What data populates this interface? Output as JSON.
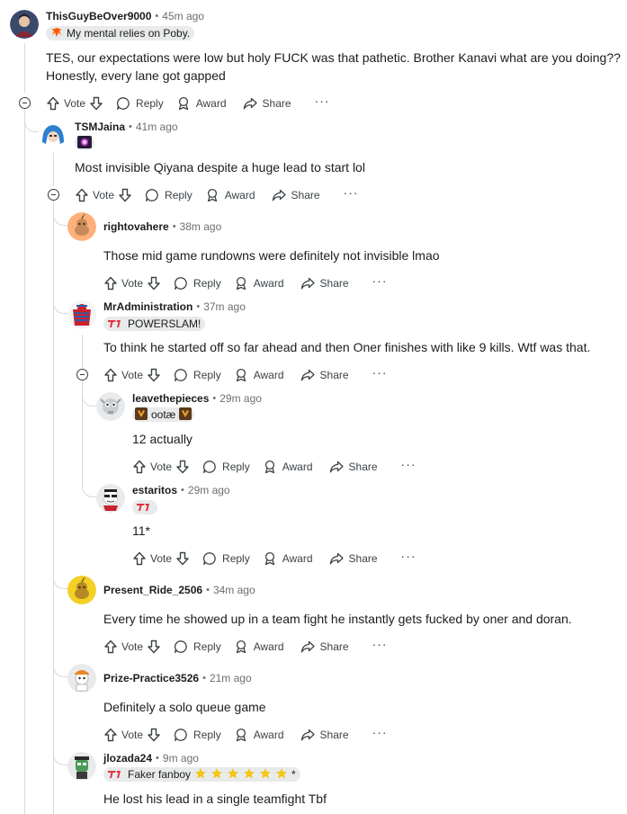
{
  "labels": {
    "vote": "Vote",
    "reply": "Reply",
    "award": "Award",
    "share": "Share",
    "more": "···",
    "sep": "•"
  },
  "colors": {
    "text": "#1c1c1c",
    "meta": "#6b6f71",
    "thread": "#d6dadc",
    "t1_red": "#e0313c",
    "fnatic_orange": "#ff5900",
    "star": "#f5c518"
  },
  "comments": [
    {
      "author": "ThisGuyBeOver9000",
      "time": "45m ago",
      "flair": "My mental relies on Poby.",
      "flair_icon": "fnatic-logo-icon",
      "avatar": "avatar-thisguy",
      "body": [
        "TES, our expectations were low but holy FUCK was that pathetic. Brother Kanavi what are you doing??",
        "Honestly, every lane got gapped"
      ]
    },
    {
      "author": "TSMJaina",
      "time": "41m ago",
      "flair": "",
      "flair_icon": "tsm-flair-icon",
      "avatar": "avatar-tsmjaina",
      "body": [
        "Most invisible Qiyana despite a huge lead to start lol"
      ]
    },
    {
      "author": "rightovahere",
      "time": "38m ago",
      "avatar": "avatar-snoo-orange",
      "body": [
        "Those mid game rundowns were definitely not invisible lmao"
      ]
    },
    {
      "author": "MrAdministration",
      "time": "37m ago",
      "flair": "POWERSLAM!",
      "flair_icon": "t1-logo-icon",
      "avatar": "avatar-mradmin",
      "body": [
        "To think he started off so far ahead and then Oner finishes with like 9 kills. Wtf was that."
      ]
    },
    {
      "author": "leavethepieces",
      "time": "29m ago",
      "flair": "ootæ",
      "flair_icon": "champion-icon",
      "avatar": "avatar-leave",
      "body": [
        "12 actually"
      ]
    },
    {
      "author": "estaritos",
      "time": "29m ago",
      "flair": "",
      "flair_icon": "t1-logo-icon",
      "avatar": "avatar-estaritos",
      "body": [
        "11*"
      ]
    },
    {
      "author": "Present_Ride_2506",
      "time": "34m ago",
      "avatar": "avatar-snoo-yellow",
      "body": [
        "Every time he showed up in a team fight he instantly gets fucked by oner and doran."
      ]
    },
    {
      "author": "Prize-Practice3526",
      "time": "21m ago",
      "avatar": "avatar-snoo-cap",
      "body": [
        "Definitely a solo queue game"
      ]
    },
    {
      "author": "jlozada24",
      "time": "9m ago",
      "flair": "Faker fanboy",
      "flair_icon": "t1-logo-icon",
      "flair_suffix": "*",
      "avatar": "avatar-jlozada",
      "body": [
        "He lost his lead in a single teamfight Tbf"
      ]
    }
  ]
}
